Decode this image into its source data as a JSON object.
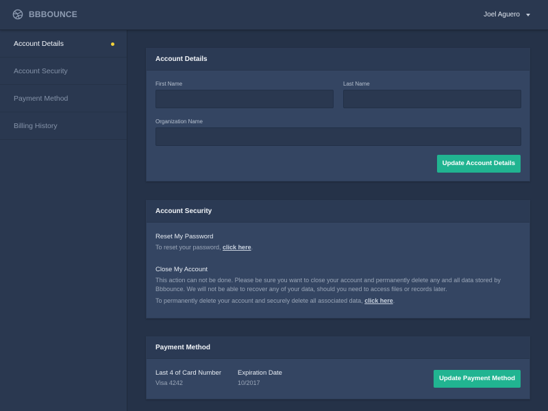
{
  "brand": {
    "name": "BBBOUNCE",
    "icon": "basketball-icon"
  },
  "user": {
    "name": "Joel Aguero",
    "menu_icon": "caret-down-icon"
  },
  "colors": {
    "accent": "#21b491",
    "active_dot": "#f2d13a",
    "background": "#253248",
    "card": "#344562"
  },
  "sidebar": {
    "items": [
      {
        "label": "Account Details",
        "active": true
      },
      {
        "label": "Account Security",
        "active": false
      },
      {
        "label": "Payment Method",
        "active": false
      },
      {
        "label": "Billing History",
        "active": false
      }
    ]
  },
  "account_details": {
    "title": "Account Details",
    "first_name": {
      "label": "First Name",
      "value": "",
      "placeholder": ""
    },
    "last_name": {
      "label": "Last Name",
      "value": "",
      "placeholder": ""
    },
    "organization": {
      "label": "Organization Name",
      "value": "",
      "placeholder": ""
    },
    "button": "Update Account Details"
  },
  "account_security": {
    "title": "Account Security",
    "reset": {
      "title": "Reset My Password",
      "text_before": "To reset your password, ",
      "link": "click here",
      "text_after": "."
    },
    "close": {
      "title": "Close My Account",
      "warning": "This action can not be done. Please be sure you want to close your account and permanently delete any and all data stored by Bbbounce. We will not be able to recover any of your data, should you need to access files or records later.",
      "text_before": "To permanently delete your account and securely delete all associated data, ",
      "link": "click here",
      "text_after": "."
    }
  },
  "payment_method": {
    "title": "Payment Method",
    "card_label": "Last 4 of Card Number",
    "card_value": "Visa 4242",
    "expiration_label": "Expiration Date",
    "expiration_value": "10/2017",
    "button": "Update Payment Method"
  }
}
